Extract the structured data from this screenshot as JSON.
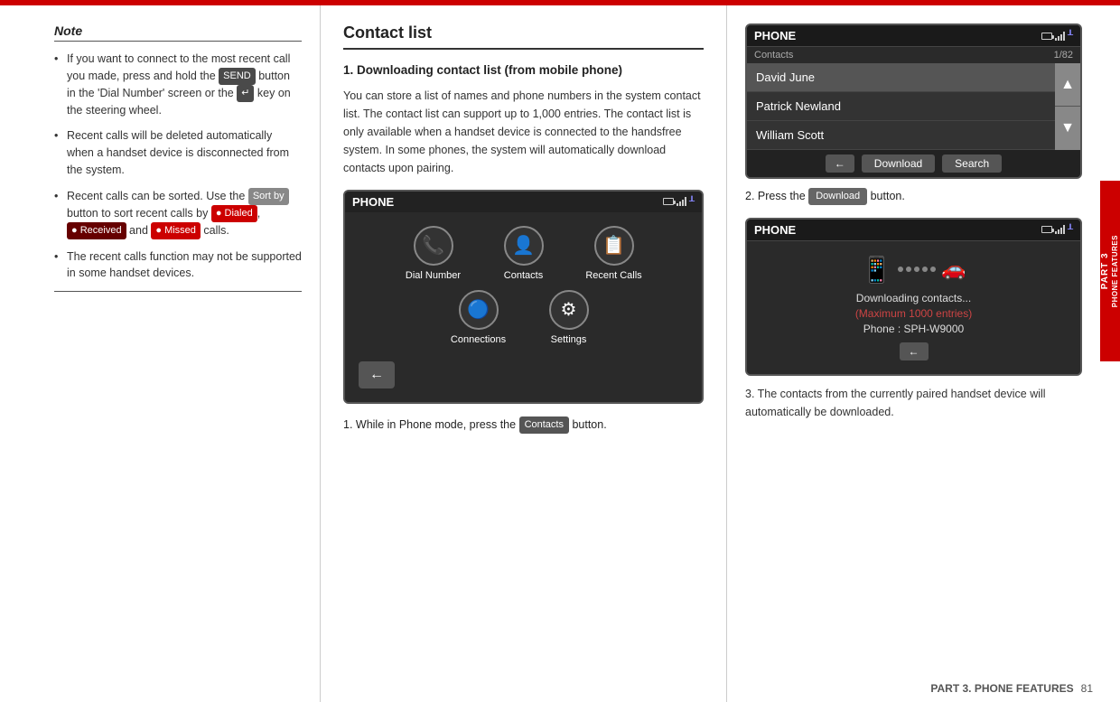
{
  "page": {
    "top_bar_color": "#cc0000",
    "side_tab_label": "PART 3",
    "side_tab_sublabel": "PHONE FEATURES"
  },
  "note": {
    "title": "Note",
    "items": [
      "If you want to connect to the most recent call you made, press and hold the  button in the 'Dial Number' screen or the  key on the steering wheel.",
      "Recent calls will be deleted automatically when a handset device is disconnected from the system.",
      "Recent calls can be sorted. Use the  button to sort recent calls by  Dialed ,  Received  and  Missed  calls.",
      "The recent calls function may not be supported in some handset devices."
    ],
    "badges": {
      "send": "SEND",
      "green_key": "↵",
      "sort_by": "Sort by",
      "dialed": "● Dialed",
      "received": "● Received",
      "missed": "● Missed"
    }
  },
  "contact_list": {
    "title": "Contact list",
    "step1": {
      "heading": "1. Downloading contact list (from mobile phone)",
      "body": "You can store a list of names and phone numbers in the system contact list. The contact list can support up to 1,000 entries. The contact list is only available when a handset device is connected to the handsfree system. In some phones, the system will automatically download contacts upon pairing."
    },
    "step1_sub": {
      "label": "1. While in Phone mode, press the",
      "badge": "Contacts",
      "label2": "button."
    },
    "phone_screen_main": {
      "header_title": "PHONE",
      "menu_items": [
        {
          "label": "Dial Number",
          "icon": "📞"
        },
        {
          "label": "Contacts",
          "icon": "👤"
        },
        {
          "label": "Recent Calls",
          "icon": "📋"
        },
        {
          "label": "Connections",
          "icon": "🔵"
        },
        {
          "label": "Settings",
          "icon": "⚙"
        }
      ]
    },
    "phone_screen_contacts": {
      "header_title": "PHONE",
      "subheader_left": "Contacts",
      "subheader_right": "1/82",
      "contacts": [
        {
          "name": "David June",
          "selected": true
        },
        {
          "name": "Patrick Newland",
          "selected": false
        },
        {
          "name": "William Scott",
          "selected": false
        }
      ],
      "buttons": {
        "back": "←",
        "download": "Download",
        "search": "Search"
      }
    }
  },
  "step2": {
    "label": "2. Press the",
    "badge": "Download",
    "label2": "button."
  },
  "phone_screen_downloading": {
    "header_title": "PHONE",
    "text1": "Downloading contacts...",
    "text2": "(Maximum 1000 entries)",
    "text3": "Phone : SPH-W9000",
    "back_btn": "←"
  },
  "step3": {
    "text": "3. The contacts from the currently paired handset device will automatically be downloaded."
  },
  "footer": {
    "left": "PART 3. PHONE FEATURES",
    "right": "81"
  }
}
